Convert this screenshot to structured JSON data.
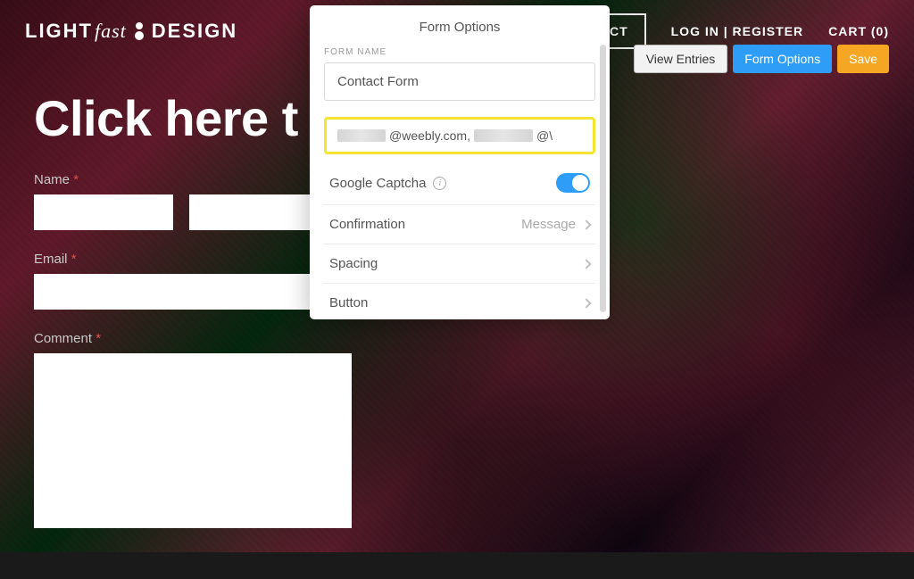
{
  "brand": {
    "light": "LIGHT",
    "fast": "fast",
    "design": "DESIGN"
  },
  "nav": {
    "contact": "ACT",
    "login_register": "LOG IN | REGISTER",
    "cart": "CART (0)"
  },
  "toolbar": {
    "view_entries": "View Entries",
    "form_options": "Form Options",
    "save": "Save"
  },
  "hero": {
    "title": "Click here t"
  },
  "fields": {
    "name_label": "Name",
    "email_label": "Email",
    "comment_label": "Comment",
    "required_mark": "*"
  },
  "popover": {
    "title": "Form Options",
    "form_name_label": "FORM NAME",
    "form_name_value": "Contact Form",
    "email_domain": "@weebly.com,",
    "email_tail": "@\\",
    "rows": {
      "captcha": {
        "label": "Google Captcha",
        "on": true
      },
      "confirmation": {
        "label": "Confirmation",
        "value": "Message"
      },
      "spacing": {
        "label": "Spacing"
      },
      "button": {
        "label": "Button"
      }
    }
  }
}
